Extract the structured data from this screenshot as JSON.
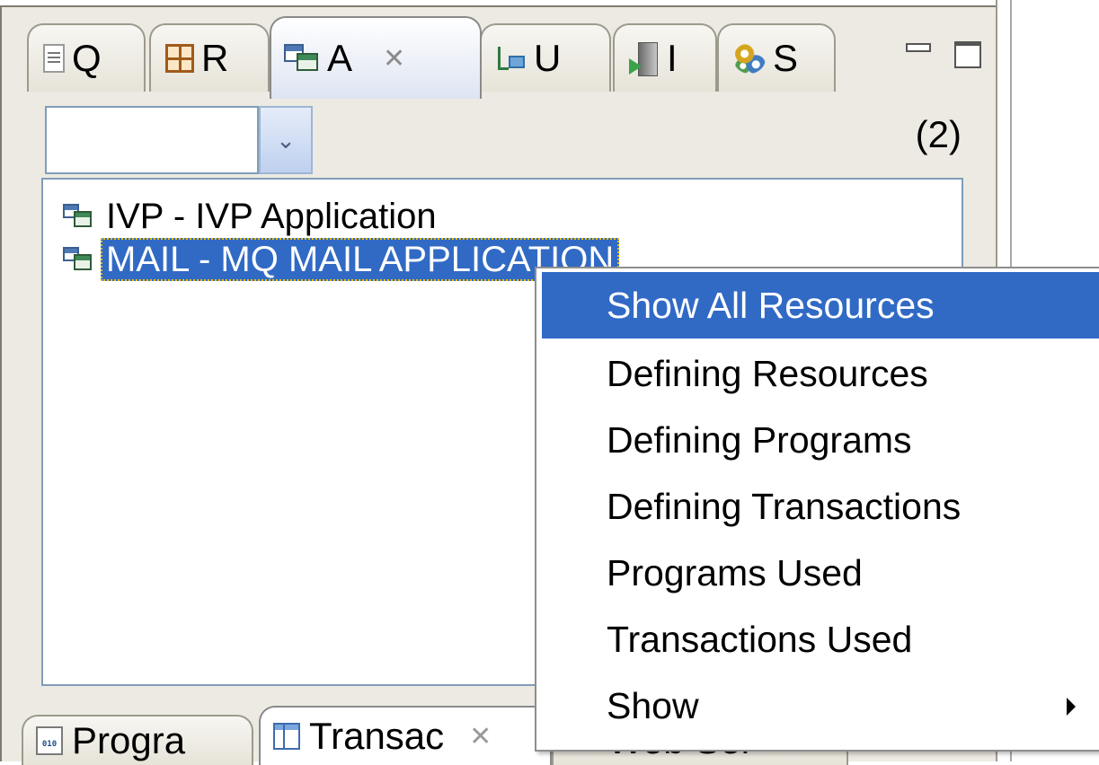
{
  "top_tabs": [
    {
      "label": "Q",
      "icon": "document-icon"
    },
    {
      "label": "R",
      "icon": "grid-icon"
    },
    {
      "label": "A",
      "icon": "application-icon",
      "active": true
    },
    {
      "label": "U",
      "icon": "tree-icon"
    },
    {
      "label": "I",
      "icon": "server-icon"
    },
    {
      "label": "S",
      "icon": "gears-icon"
    }
  ],
  "close_glyph": "✕",
  "filter": {
    "value": "",
    "placeholder": ""
  },
  "dropdown_glyph": "⌄",
  "count_label": "(2)",
  "list_items": [
    {
      "label": "IVP - IVP Application",
      "selected": false
    },
    {
      "label": "MAIL - MQ MAIL APPLICATION",
      "selected": true
    }
  ],
  "context_menu": {
    "items": [
      {
        "label": "Show All Resources",
        "highlighted": true
      },
      {
        "label": "Defining Resources"
      },
      {
        "label": "Defining Programs"
      },
      {
        "label": "Defining Transactions"
      },
      {
        "label": "Programs Used"
      },
      {
        "label": "Transactions Used"
      },
      {
        "label": "Show",
        "has_submenu": true
      }
    ]
  },
  "bottom_tabs": [
    {
      "label": "Progra",
      "icon": "binary-file-icon"
    },
    {
      "label": "Transac",
      "icon": "table-icon",
      "active": true
    },
    {
      "label": "Web Ser",
      "icon": "web-service-icon"
    }
  ],
  "binary_icon_text": "010",
  "colors": {
    "selection": "#316ac5",
    "panel": "#eceae2",
    "border": "#7f9db9"
  }
}
